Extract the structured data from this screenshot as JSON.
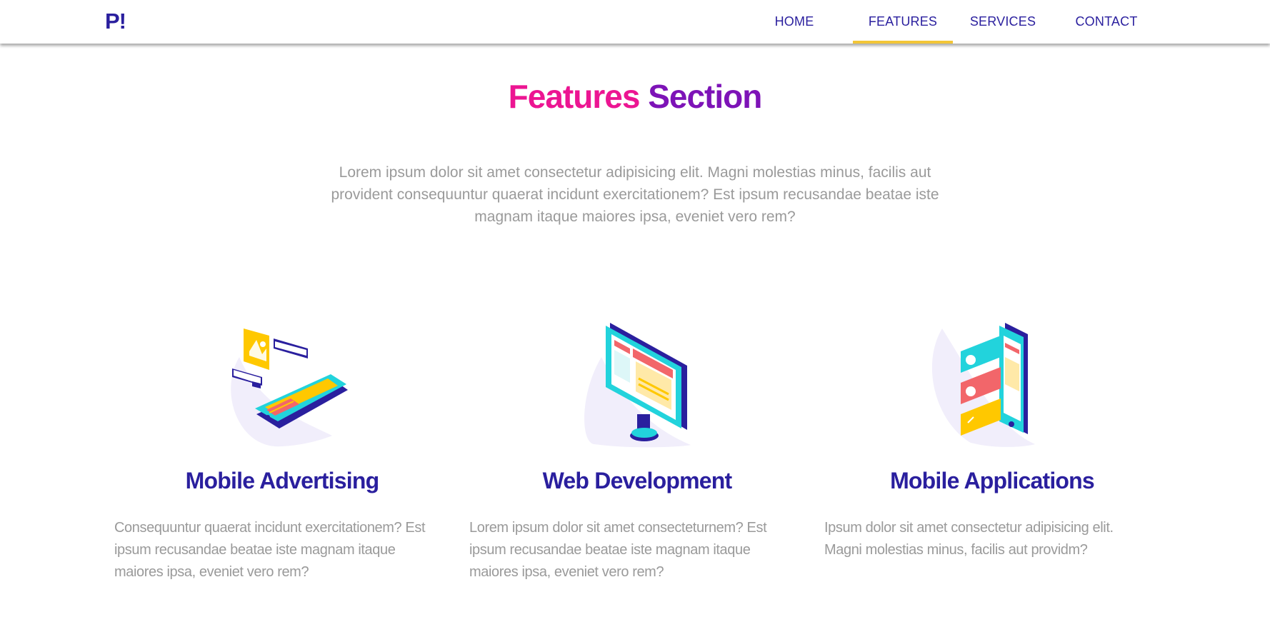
{
  "brand": {
    "logo": "P!"
  },
  "nav": {
    "items": [
      {
        "label": "HOME",
        "active": false
      },
      {
        "label": "FEATURES",
        "active": true
      },
      {
        "label": "SERVICES",
        "active": false
      },
      {
        "label": "CONTACT",
        "active": false
      }
    ]
  },
  "hero": {
    "title_part1": "Features",
    "title_part2": "Section",
    "description": "Lorem ipsum dolor sit amet consectetur adipisicing elit. Magni molestias minus, facilis aut provident consequuntur quaerat incidunt exercitationem? Est ipsum recusandae beatae iste magnam itaque maiores ipsa, eveniet vero rem?"
  },
  "features": [
    {
      "title": "Mobile Advertising",
      "icon": "mobile-advertising-illustration",
      "text": "Consequuntur quaerat incidunt exercitationem? Est ipsum recusandae beatae iste magnam itaque maiores ipsa, eveniet vero rem?"
    },
    {
      "title": "Web Development",
      "icon": "web-development-illustration",
      "text": "Lorem ipsum dolor sit amet consecteturnem? Est ipsum recusandae beatae iste magnam itaque maiores ipsa, eveniet vero rem?"
    },
    {
      "title": "Mobile Applications",
      "icon": "mobile-applications-illustration",
      "text": "Ipsum dolor sit amet consectetur adipisicing elit. Magni molestias minus, facilis aut providm?"
    }
  ],
  "colors": {
    "brand_navy": "#2a1f9e",
    "title_pink": "#ec1592",
    "title_purple": "#7d13b7",
    "nav_active_underline": "#f3c637",
    "body_text": "#9a9a9a",
    "accent_cyan": "#22d3dc",
    "accent_yellow": "#ffc800",
    "accent_red": "#f2666a"
  }
}
